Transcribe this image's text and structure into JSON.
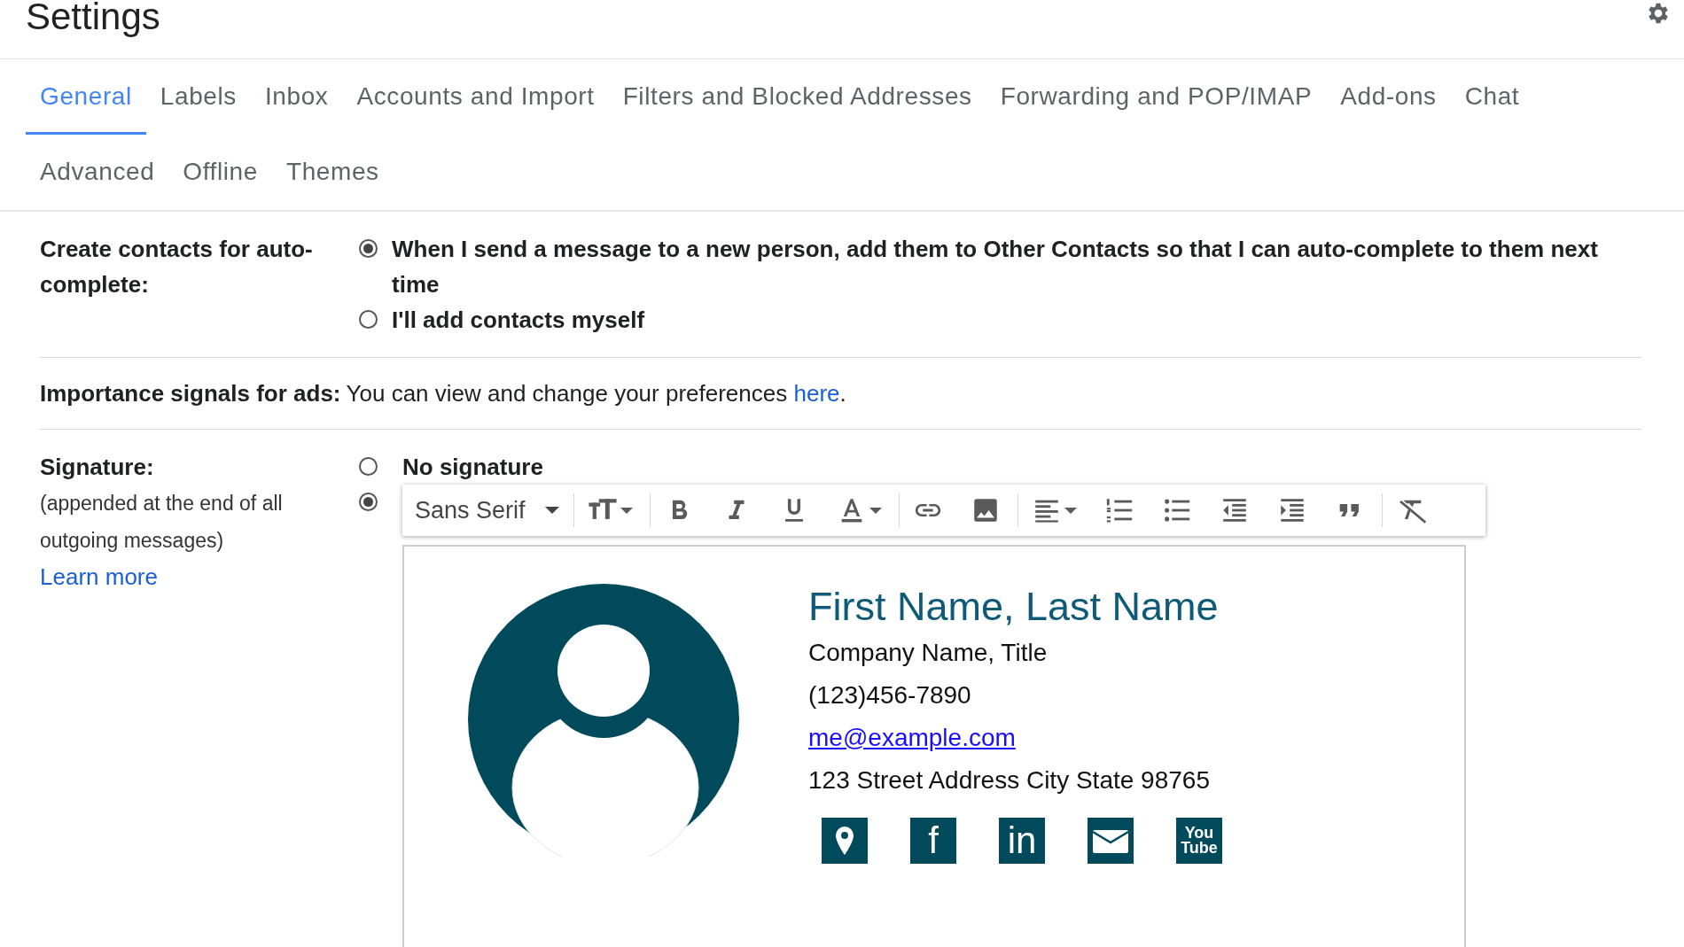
{
  "header": {
    "title": "Settings"
  },
  "tabs": [
    {
      "label": "General",
      "selected": true
    },
    {
      "label": "Labels",
      "selected": false
    },
    {
      "label": "Inbox",
      "selected": false
    },
    {
      "label": "Accounts and Import",
      "selected": false
    },
    {
      "label": "Filters and Blocked Addresses",
      "selected": false
    },
    {
      "label": "Forwarding and POP/IMAP",
      "selected": false
    },
    {
      "label": "Add-ons",
      "selected": false
    },
    {
      "label": "Chat",
      "selected": false
    },
    {
      "label": "Advanced",
      "selected": false
    },
    {
      "label": "Offline",
      "selected": false
    },
    {
      "label": "Themes",
      "selected": false
    }
  ],
  "contacts": {
    "label": "Create contacts for auto-complete:",
    "options": [
      {
        "text": "When I send a message to a new person, add them to Other Contacts so that I can auto-complete to them next time",
        "selected": true
      },
      {
        "text": "I'll add contacts myself",
        "selected": false
      }
    ]
  },
  "ads": {
    "label": "Importance signals for ads:",
    "text": "You can view and change your preferences ",
    "link": "here",
    "end": "."
  },
  "signature": {
    "label": "Signature:",
    "note": "(appended at the end of all outgoing messages)",
    "link": "Learn more",
    "options": [
      {
        "text": "No signature",
        "selected": false
      },
      {
        "selected": true
      }
    ],
    "toolbar": {
      "font": "Sans Serif",
      "tools": [
        {
          "kind": "size",
          "menu": true,
          "separated": true
        },
        {
          "kind": "bold",
          "menu": false,
          "separated": true
        },
        {
          "kind": "italic",
          "menu": false,
          "separated": false
        },
        {
          "kind": "underline",
          "menu": false,
          "separated": false
        },
        {
          "kind": "color",
          "menu": true,
          "separated": false
        },
        {
          "kind": "link",
          "menu": false,
          "separated": true
        },
        {
          "kind": "image",
          "menu": false,
          "separated": false
        },
        {
          "kind": "align",
          "menu": true,
          "separated": true
        },
        {
          "kind": "numbered",
          "menu": false,
          "separated": false
        },
        {
          "kind": "bulleted",
          "menu": false,
          "separated": false
        },
        {
          "kind": "outdent",
          "menu": false,
          "separated": false
        },
        {
          "kind": "indent",
          "menu": false,
          "separated": false
        },
        {
          "kind": "quote",
          "menu": false,
          "separated": false
        },
        {
          "kind": "clear",
          "menu": false,
          "separated": true
        }
      ]
    },
    "card": {
      "name": "First Name, Last Name",
      "company": "Company Name, Title",
      "phone": "(123)456-7890",
      "email": "me@example.com",
      "address": "123 Street Address City State 98765",
      "social": [
        {
          "kind": "pin"
        },
        {
          "kind": "letter",
          "text": "f"
        },
        {
          "kind": "letter",
          "text": "in"
        },
        {
          "kind": "mail"
        },
        {
          "kind": "video",
          "text": [
            "You",
            "Tube"
          ]
        }
      ]
    }
  }
}
